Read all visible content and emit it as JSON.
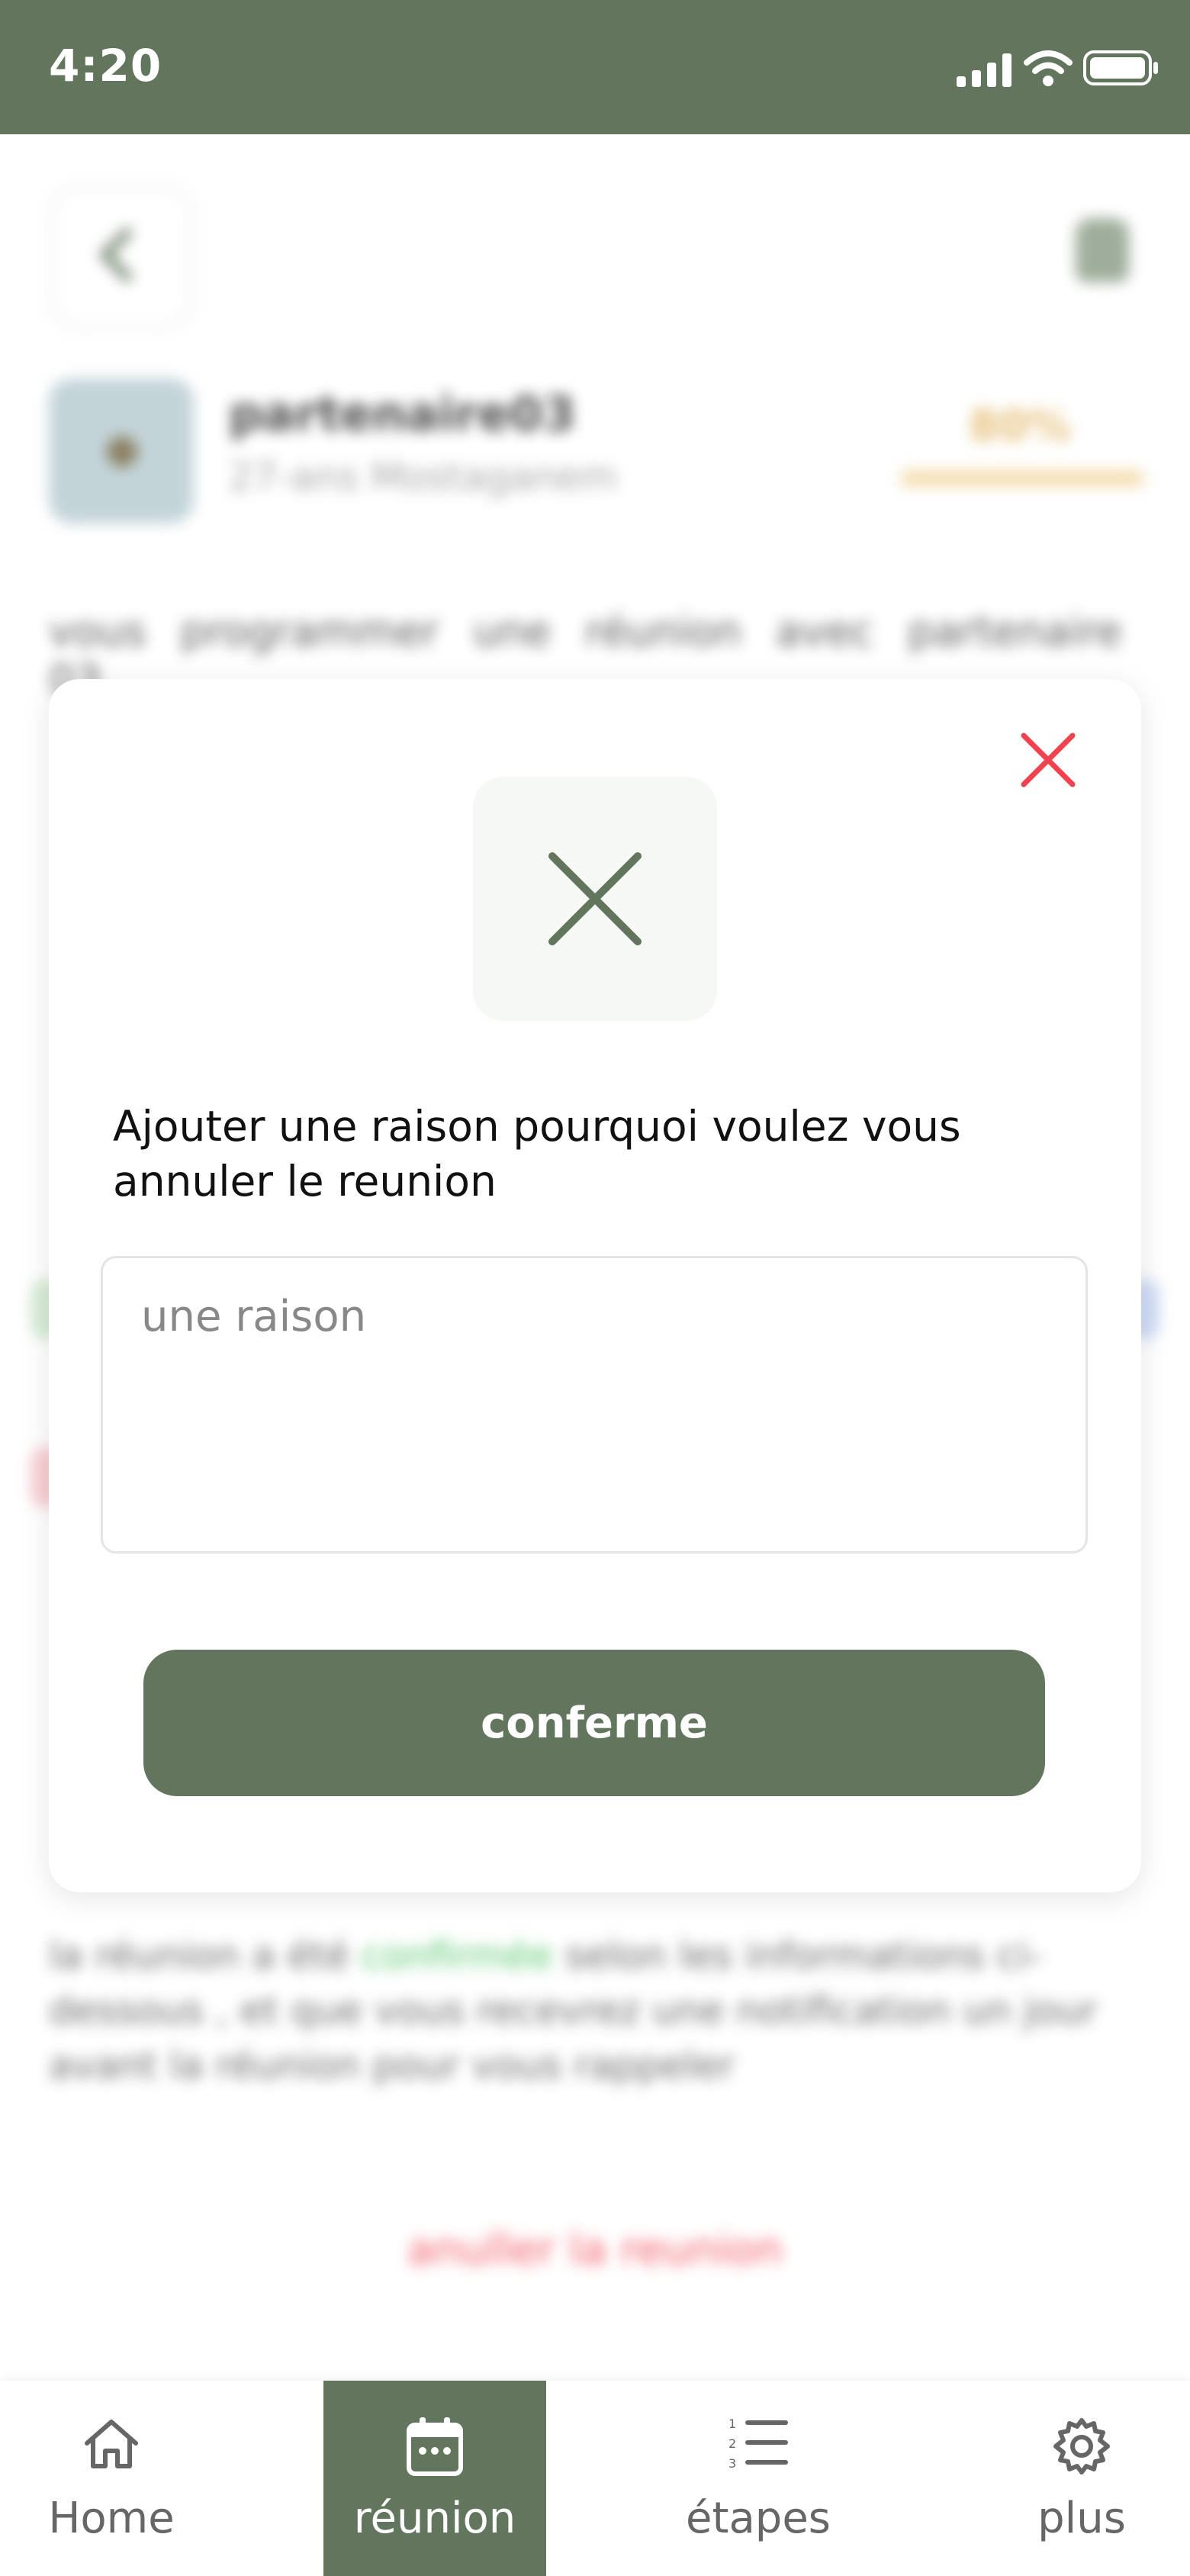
{
  "status_bar": {
    "time": "4:20"
  },
  "background": {
    "partner_name": "partenaire03",
    "partner_location": "27-ans Mostaganem",
    "compatibility_value": "80%",
    "intro_text": "vous programmer une réunion avec partenaire 03",
    "info_part1": "la réunion a été ",
    "info_status": "confirmée",
    "info_part2": " selon les informations ci-",
    "info_line2": "dessous , et que vous recevrez une notification un jour",
    "info_line3": "avant la réunion pour vous rappeler",
    "cancel_link": "anuller la reunion"
  },
  "modal": {
    "prompt": "Ajouter une raison pourquoi voulez vous annuler le reunion",
    "input_placeholder": "une raison",
    "input_value": "",
    "confirm_label": "conferme"
  },
  "bottom_nav": {
    "items": [
      {
        "label": "Home",
        "icon": "home-icon",
        "active": false
      },
      {
        "label": "réunion",
        "icon": "calendar-icon",
        "active": true
      },
      {
        "label": "étapes",
        "icon": "numbered-list-icon",
        "active": false
      },
      {
        "label": "plus",
        "icon": "gear-icon",
        "active": false
      }
    ]
  },
  "colors": {
    "primary": "#61765d",
    "danger": "#ef4350",
    "accent_orange": "#e2b86a",
    "success": "#3fbf58"
  }
}
